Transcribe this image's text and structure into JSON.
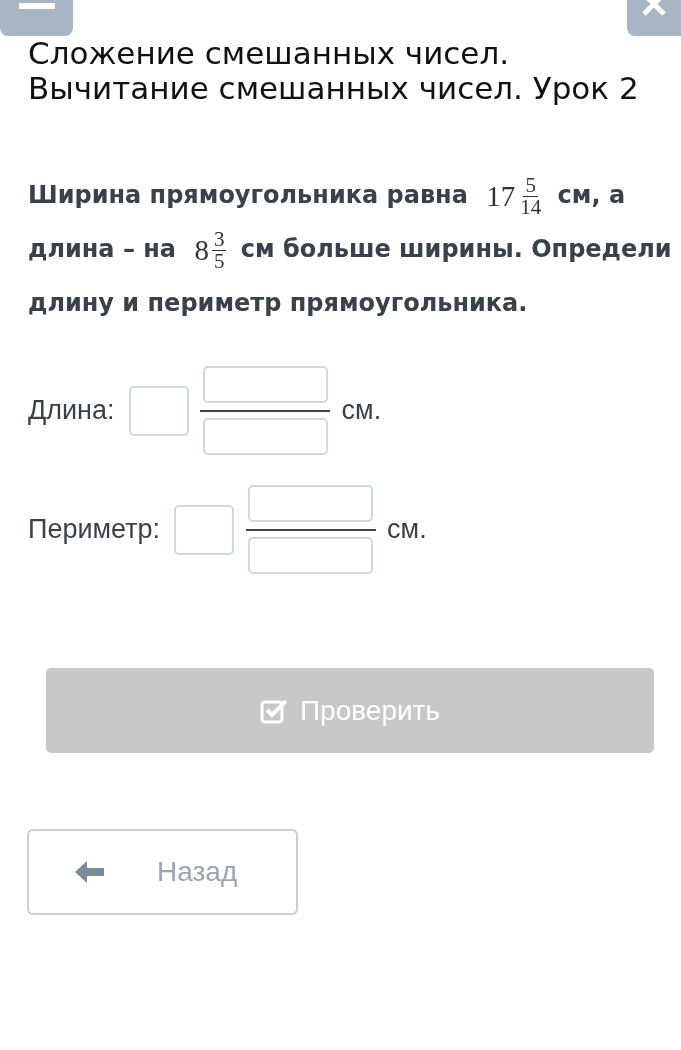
{
  "title": "Сложение смешанных чисел. Вычитание смешанных чисел. Урок 2",
  "problem": [
    {
      "kind": "text",
      "text": "Ширина прямоугольника равна"
    },
    {
      "kind": "mixed",
      "whole": "17",
      "numerator": "5",
      "denominator": "14"
    },
    {
      "kind": "text",
      "text": "см, а длина – на"
    },
    {
      "kind": "mixed",
      "whole": "8",
      "numerator": "3",
      "denominator": "5"
    },
    {
      "kind": "text",
      "text": "см больше ширины. Определи длину и периметр прямоугольника."
    }
  ],
  "answers": [
    {
      "label": "Длина:",
      "unit": "см."
    },
    {
      "label": "Периметр:",
      "unit": "см."
    }
  ],
  "check_button": {
    "label": "Проверить",
    "disabled": true
  },
  "back_button": {
    "label": "Назад"
  }
}
